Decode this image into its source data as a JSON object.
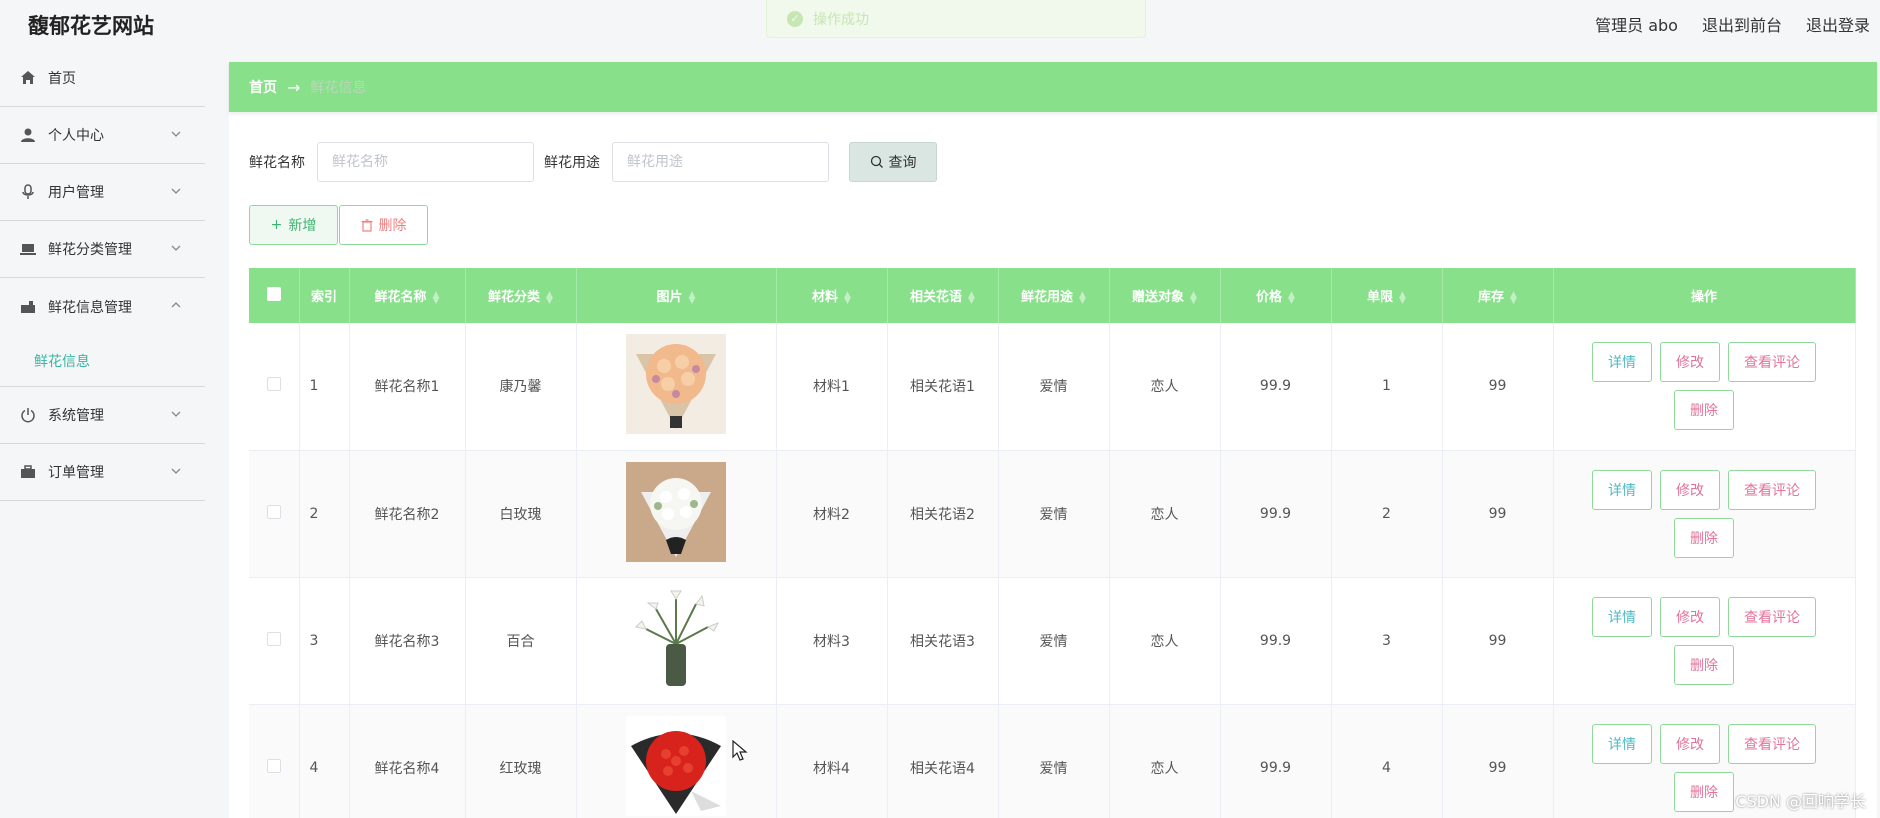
{
  "header": {
    "site_title": "馥郁花艺网站",
    "admin_label": "管理员 abo",
    "to_front": "退出到前台",
    "logout": "退出登录"
  },
  "toast": {
    "message": "操作成功"
  },
  "sidebar": {
    "items": [
      {
        "label": "首页",
        "icon": "home-icon"
      },
      {
        "label": "个人中心",
        "icon": "user-icon"
      },
      {
        "label": "用户管理",
        "icon": "mic-icon"
      },
      {
        "label": "鲜花分类管理",
        "icon": "laptop-icon"
      },
      {
        "label": "鲜花信息管理",
        "icon": "cart-icon"
      },
      {
        "label": "系统管理",
        "icon": "power-icon"
      },
      {
        "label": "订单管理",
        "icon": "briefcase-icon"
      }
    ],
    "submenu_label": "鲜花信息"
  },
  "breadcrumb": {
    "home": "首页",
    "arrow": "→",
    "current": "鲜花信息"
  },
  "search": {
    "name_label": "鲜花名称",
    "name_placeholder": "鲜花名称",
    "use_label": "鲜花用途",
    "use_placeholder": "鲜花用途",
    "query_button": "查询"
  },
  "actions": {
    "add": "新增",
    "delete": "删除"
  },
  "table": {
    "headers": [
      "索引",
      "鲜花名称",
      "鲜花分类",
      "图片",
      "材料",
      "相关花语",
      "鲜花用途",
      "赠送对象",
      "价格",
      "单限",
      "库存",
      "操作"
    ],
    "rows": [
      {
        "index": "1",
        "name": "鲜花名称1",
        "category": "康乃馨",
        "material": "材料1",
        "language": "相关花语1",
        "use": "爱情",
        "target": "恋人",
        "price": "99.9",
        "limit": "1",
        "stock": "99"
      },
      {
        "index": "2",
        "name": "鲜花名称2",
        "category": "白玫瑰",
        "material": "材料2",
        "language": "相关花语2",
        "use": "爱情",
        "target": "恋人",
        "price": "99.9",
        "limit": "2",
        "stock": "99"
      },
      {
        "index": "3",
        "name": "鲜花名称3",
        "category": "百合",
        "material": "材料3",
        "language": "相关花语3",
        "use": "爱情",
        "target": "恋人",
        "price": "99.9",
        "limit": "3",
        "stock": "99"
      },
      {
        "index": "4",
        "name": "鲜花名称4",
        "category": "红玫瑰",
        "material": "材料4",
        "language": "相关花语4",
        "use": "爱情",
        "target": "恋人",
        "price": "99.9",
        "limit": "4",
        "stock": "99"
      }
    ],
    "row_actions": {
      "detail": "详情",
      "edit": "修改",
      "review": "查看评论",
      "remove": "删除"
    }
  },
  "watermark": "CSDN @回响学长",
  "colors": {
    "accent": "#89e08b",
    "teal": "#3ab5a3",
    "pink": "#e4739a"
  }
}
